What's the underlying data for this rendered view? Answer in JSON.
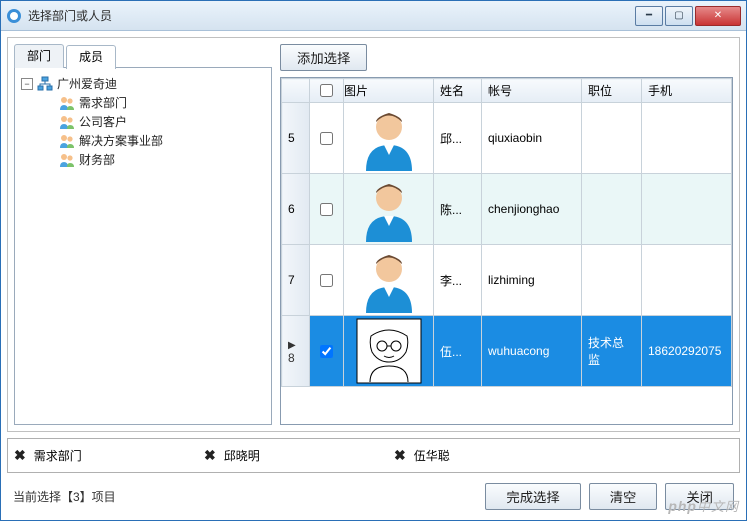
{
  "window": {
    "title": "选择部门或人员"
  },
  "tabs": {
    "dept": "部门",
    "member": "成员"
  },
  "tree": {
    "root": "广州爱奇迪",
    "children": [
      "需求部门",
      "公司客户",
      "解决方案事业部",
      "财务部"
    ]
  },
  "actions": {
    "add": "添加选择",
    "finish": "完成选择",
    "clear": "清空",
    "close": "关闭"
  },
  "grid": {
    "headers": {
      "pic": "图片",
      "name": "姓名",
      "account": "帐号",
      "position": "职位",
      "phone": "手机"
    },
    "rows": [
      {
        "num": "5",
        "checked": false,
        "avatar": "blue",
        "name": "邱...",
        "account": "qiuxiaobin",
        "position": "",
        "phone": "",
        "alt": false,
        "selected": false
      },
      {
        "num": "6",
        "checked": false,
        "avatar": "blue",
        "name": "陈...",
        "account": "chenjionghao",
        "position": "",
        "phone": "",
        "alt": true,
        "selected": false
      },
      {
        "num": "7",
        "checked": false,
        "avatar": "blue",
        "name": "李...",
        "account": "lizhiming",
        "position": "",
        "phone": "",
        "alt": false,
        "selected": false
      },
      {
        "num": "8",
        "checked": true,
        "avatar": "sketch",
        "name": "伍...",
        "account": "wuhuacong",
        "position": "技术总监",
        "phone": "18620292075",
        "alt": true,
        "selected": true
      }
    ]
  },
  "chosen": [
    "需求部门",
    "邱晓明",
    "伍华聪"
  ],
  "status": "当前选择【3】项目",
  "watermark": "php中文网"
}
